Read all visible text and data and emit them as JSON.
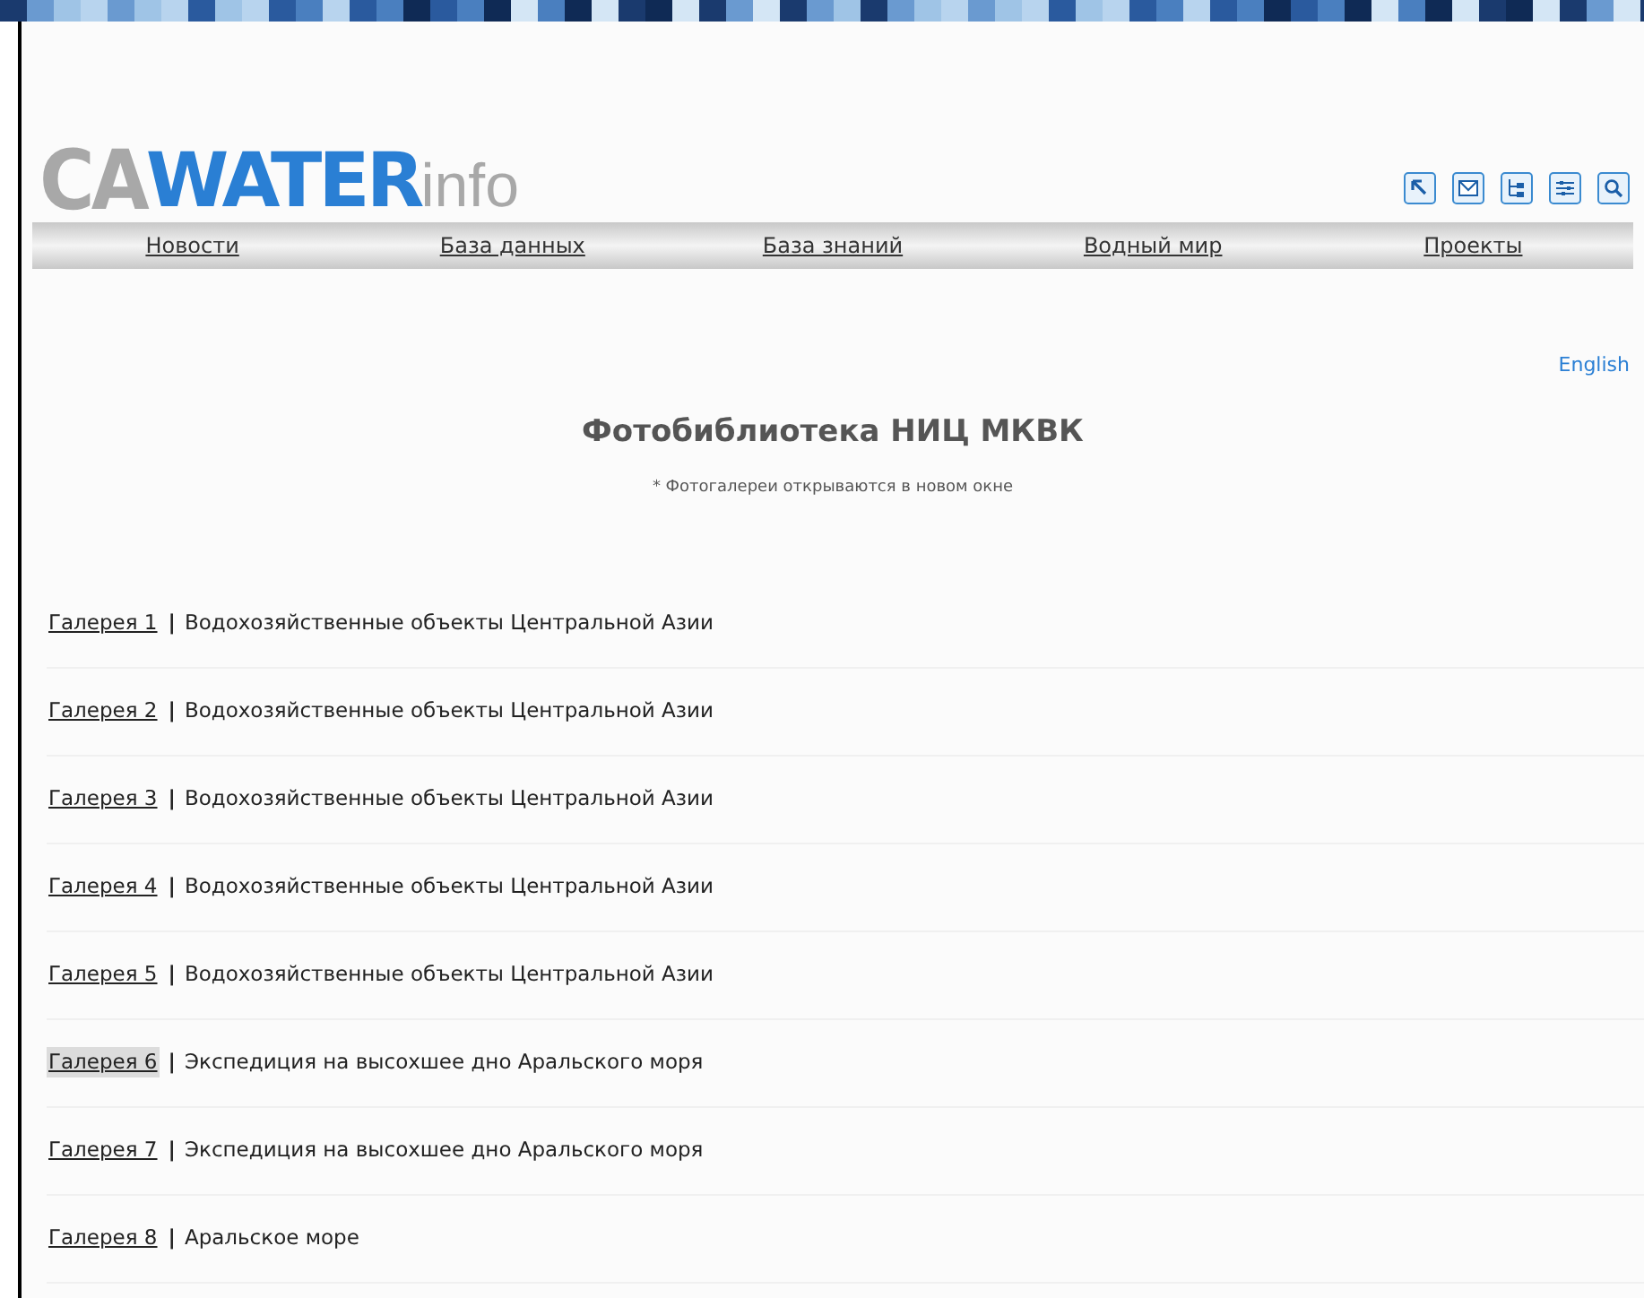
{
  "logo": {
    "bold_gray": "CA",
    "bold_blue": "WATER",
    "light": "info"
  },
  "nav": [
    "Новости",
    "База данных",
    "База знаний",
    "Водный мир",
    "Проекты"
  ],
  "language_link": "English",
  "title": "Фотобиблиотека НИЦ МКВК",
  "note": "* Фотогалереи открываются в новом окне",
  "galleries": [
    {
      "link": "Галерея 1",
      "separator": "|",
      "description": "Водохозяйственные объекты Центральной Азии",
      "selected": false
    },
    {
      "link": "Галерея 2",
      "separator": "|",
      "description": "Водохозяйственные объекты Центральной Азии",
      "selected": false
    },
    {
      "link": "Галерея 3",
      "separator": "|",
      "description": "Водохозяйственные объекты Центральной Азии",
      "selected": false
    },
    {
      "link": "Галерея 4",
      "separator": "|",
      "description": "Водохозяйственные объекты Центральной Азии",
      "selected": false
    },
    {
      "link": "Галерея 5",
      "separator": "|",
      "description": "Водохозяйственные объекты Центральной Азии",
      "selected": false
    },
    {
      "link": "Галерея 6",
      "separator": "|",
      "description": "Экспедиция на высохшее дно Аральского моря",
      "selected": true
    },
    {
      "link": "Галерея 7",
      "separator": "|",
      "description": "Экспедиция на высохшее дно Аральского моря",
      "selected": false
    },
    {
      "link": "Галерея 8",
      "separator": "|",
      "description": "Аральское море",
      "selected": false
    }
  ]
}
